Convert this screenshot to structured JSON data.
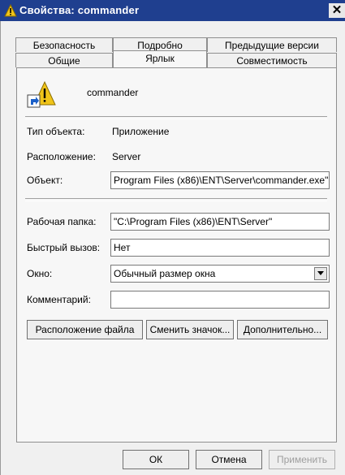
{
  "window": {
    "title": "Свойства: commander",
    "close_label": "✕"
  },
  "tabs": {
    "row1": [
      "Безопасность",
      "Подробно",
      "Предыдущие версии"
    ],
    "row2": [
      "Общие",
      "Ярлык",
      "Совместимость"
    ],
    "active": "Ярлык"
  },
  "shortcut": {
    "name": "commander"
  },
  "fields": {
    "type_label": "Тип объекта:",
    "type_value": "Приложение",
    "location_label": "Расположение:",
    "location_value": "Server",
    "target_label": "Объект:",
    "target_value": "Program Files (x86)\\ENT\\Server\\commander.exe\"",
    "start_label": "Рабочая папка:",
    "start_value": "\"C:\\Program Files (x86)\\ENT\\Server\"",
    "hotkey_label": "Быстрый вызов:",
    "hotkey_value": "Нет",
    "run_label": "Окно:",
    "run_value": "Обычный размер окна",
    "comment_label": "Комментарий:",
    "comment_value": ""
  },
  "buttons": {
    "open_location": "Расположение файла",
    "change_icon": "Сменить значок...",
    "advanced": "Дополнительно...",
    "ok": "ОК",
    "cancel": "Отмена",
    "apply": "Применить"
  },
  "colors": {
    "titlebar": "#1f3f8f",
    "warning_yellow": "#f0c419"
  }
}
